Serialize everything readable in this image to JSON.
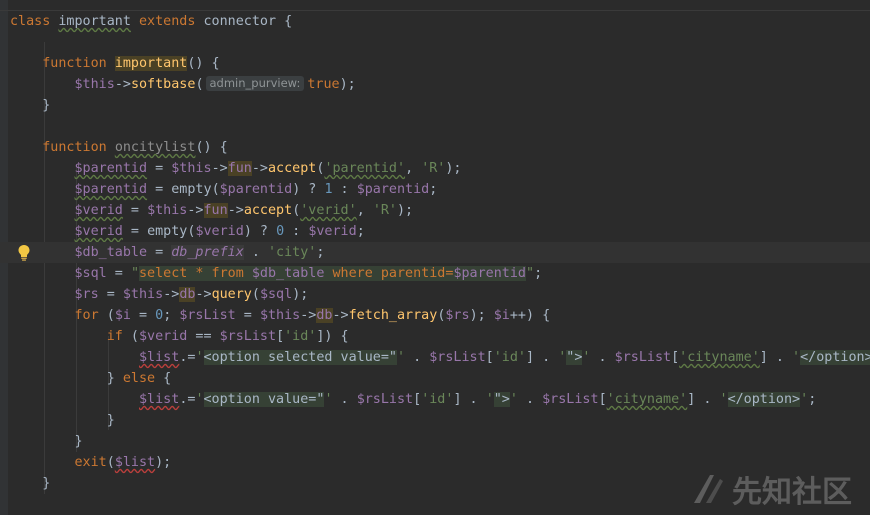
{
  "code": {
    "line1": {
      "kw_class": "class",
      "name": "important",
      "kw_extends": "extends",
      "parent": "connector",
      "brace": "{"
    },
    "line2": {
      "kw_function": "function",
      "name": "important",
      "rest": "() {"
    },
    "line3": {
      "var": "$this",
      "arrow": "->",
      "fn": "softbase",
      "open": "(",
      "hint": "admin_purview:",
      "value": "true",
      "close": ");"
    },
    "line4": {
      "text": "}"
    },
    "line5": {
      "kw_function": "function",
      "name": "oncitylist",
      "rest": "() {"
    },
    "line6": {
      "var": "$parentid",
      "eq": " = ",
      "this": "$this",
      "a1": "->",
      "prop": "fun",
      "a2": "->",
      "fn": "accept",
      "open": "(",
      "s1": "'parentid'",
      "comma": ", ",
      "s2": "'R'",
      "close": ");"
    },
    "line7": {
      "var": "$parentid",
      "eq": " = ",
      "fn": "empty",
      "open": "(",
      "arg": "$parentid",
      "mid": ") ? ",
      "num": "1",
      "colon": " : ",
      "var2": "$parentid",
      "end": ";"
    },
    "line8": {
      "var": "$verid",
      "eq": " = ",
      "this": "$this",
      "a1": "->",
      "prop": "fun",
      "a2": "->",
      "fn": "accept",
      "open": "(",
      "s1": "'verid'",
      "comma": ", ",
      "s2": "'R'",
      "close": ");"
    },
    "line9": {
      "var": "$verid",
      "eq": " = ",
      "fn": "empty",
      "open": "(",
      "arg": "$verid",
      "mid": ") ? ",
      "num": "0",
      "colon": " : ",
      "var2": "$verid",
      "end": ";"
    },
    "line10": {
      "var": "$db_table",
      "eq": " = ",
      "const": "db_prefix",
      "dot": " . ",
      "str": "'city'",
      "end": ";"
    },
    "line11": {
      "var": "$sql",
      "eq": " = ",
      "q1": "\"",
      "sql1": "select * from ",
      "v": "$db_table",
      "sql2": " where parentid=",
      "v2": "$parentid",
      "q2": "\"",
      "end": ";"
    },
    "line12": {
      "var": "$rs",
      "eq": " = ",
      "this": "$this",
      "a1": "->",
      "prop": "db",
      "a2": "->",
      "fn": "query",
      "open": "(",
      "arg": "$sql",
      "close": ");"
    },
    "line13": {
      "kw": "for",
      "p1": " (",
      "v1": "$i",
      "t1": " = ",
      "n": "0",
      "t2": "; ",
      "v2": "$rsList",
      "t3": " = ",
      "v3": "$this",
      "a1": "->",
      "prop": "db",
      "a2": "->",
      "fn": "fetch_array",
      "t4": "(",
      "v4": "$rs",
      "t5": "); ",
      "v5": "$i",
      "t6": "++) {"
    },
    "line14": {
      "kw": "if",
      "p1": " (",
      "v1": "$verid",
      "t1": " == ",
      "v2": "$rsList",
      "t2": "[",
      "s": "'id'",
      "t3": "]) {"
    },
    "line15": {
      "v": "$list",
      "t1": ".=",
      "q": "'",
      "html": "<option selected value=\"",
      "q2": "'",
      "t2": " . ",
      "v2": "$rsList",
      "t3": "[",
      "s1": "'id'",
      "t4": "] . ",
      "s2a": "'",
      "s2": "\">",
      "s2b": "'",
      "t5": " . ",
      "v3": "$rsList",
      "t6": "[",
      "s3": "'cityname'",
      "t7": "] . ",
      "s4a": "'",
      "s4": "</option>",
      "s4b": "'"
    },
    "line16": {
      "b": "}",
      "kw": " else",
      "t": " {"
    },
    "line17": {
      "v": "$list",
      "t1": ".=",
      "q": "'",
      "html": "<option value=\"",
      "q2": "'",
      "t2": " . ",
      "v2": "$rsList",
      "t3": "[",
      "s1": "'id'",
      "t4": "] . ",
      "s2a": "'",
      "s2": "\">",
      "s2b": "'",
      "t5": " . ",
      "v3": "$rsList",
      "t6": "[",
      "s3": "'cityname'",
      "t7": "] . ",
      "s4a": "'",
      "s4": "</option>",
      "s4b": "'",
      "end": ";"
    },
    "line18": {
      "text": "}"
    },
    "line19": {
      "text": "}"
    },
    "line20": {
      "fn": "exit",
      "open": "(",
      "v": "$list",
      "close": ");"
    },
    "line21": {
      "text": "}"
    }
  },
  "watermark": {
    "text": "先知社区",
    "icon": "xianzhi-logo-icon"
  },
  "colors": {
    "background": "#2b2b2b",
    "keyword": "#cc7832",
    "function": "#ffc66d",
    "variable": "#9876aa",
    "string": "#6a8759",
    "number": "#6897bb"
  }
}
